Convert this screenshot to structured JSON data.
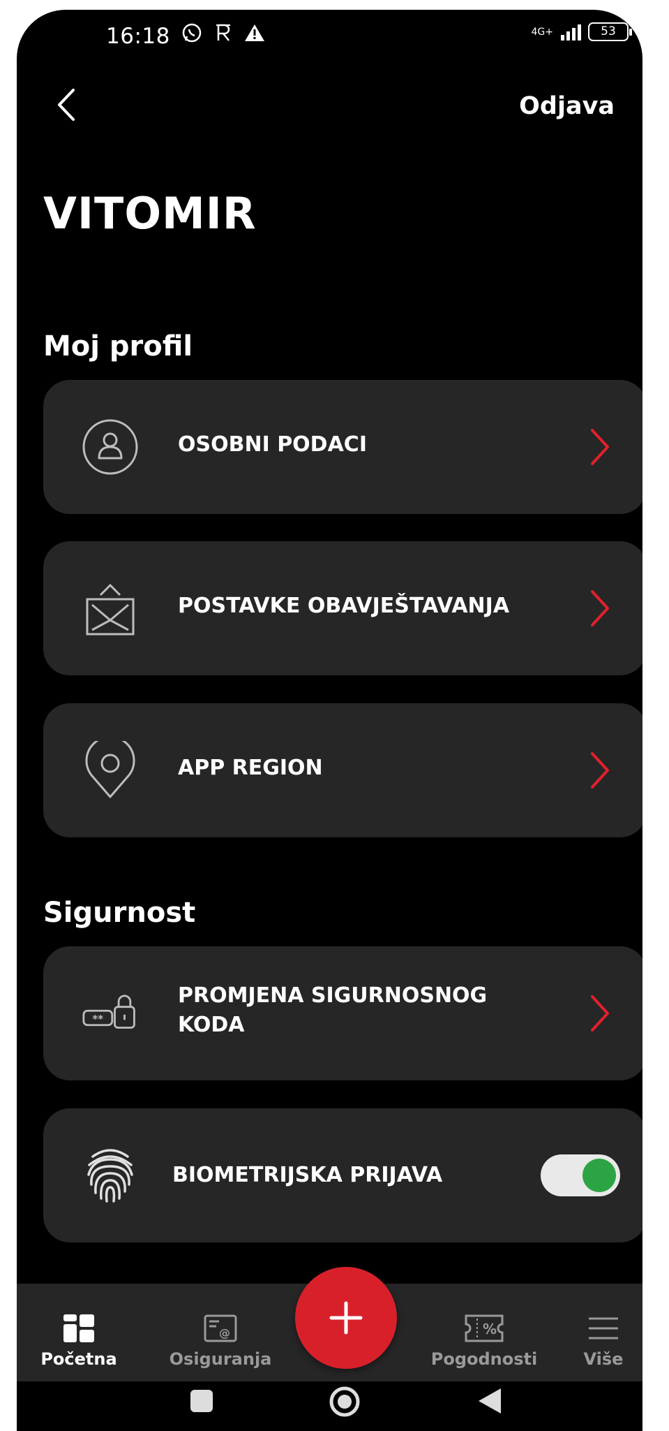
{
  "status_bar": {
    "time": "16:18",
    "network": "4G+",
    "battery": "53"
  },
  "header": {
    "logout_label": "Odjava",
    "username": "VITOMIR"
  },
  "profile_section": {
    "title": "Moj profil",
    "items": [
      {
        "label": "OSOBNI PODACI",
        "icon": "user-icon"
      },
      {
        "label": "POSTAVKE OBAVJEŠTAVANJA",
        "icon": "envelope-icon"
      },
      {
        "label": "APP REGION",
        "icon": "location-pin-icon"
      }
    ]
  },
  "security_section": {
    "title": "Sigurnost",
    "items": [
      {
        "label_line1": "PROMJENA SIGURNOSNOG",
        "label_line2": "KODA",
        "icon": "password-lock-icon"
      },
      {
        "label": "BIOMETRIJSKA PRIJAVA",
        "icon": "fingerprint-icon",
        "toggle_on": true
      }
    ]
  },
  "bottom_nav": {
    "items": [
      {
        "label": "Početna",
        "icon": "home-grid-icon",
        "active": true
      },
      {
        "label": "Osiguranja",
        "icon": "document-email-icon",
        "active": false
      },
      {
        "label": "Pogodnosti",
        "icon": "discount-ticket-icon",
        "active": false
      },
      {
        "label": "Više",
        "icon": "menu-icon",
        "active": false
      }
    ],
    "fab_icon": "plus-icon"
  },
  "colors": {
    "background": "#000000",
    "card": "#262626",
    "accent_red": "#d8202b",
    "toggle_green": "#2da443"
  }
}
